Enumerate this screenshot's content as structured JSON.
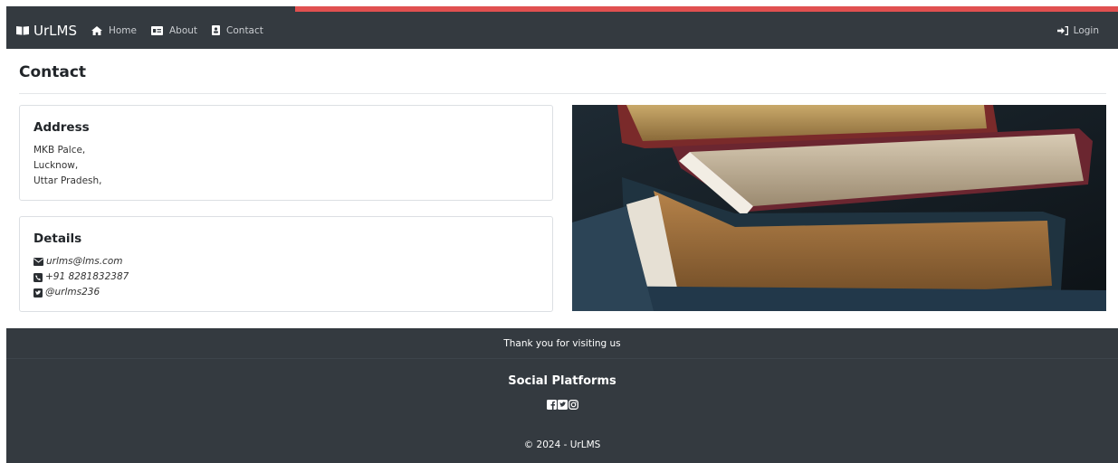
{
  "colors": {
    "navbar_bg": "#343a40",
    "progress_fill": "#e05050",
    "footer_bg": "#343a40"
  },
  "page_progress": 0.74,
  "navbar": {
    "brand": {
      "icon": "book-open-icon",
      "label": "UrLMS"
    },
    "links": [
      {
        "icon": "home-icon",
        "label": "Home"
      },
      {
        "icon": "id-card-icon",
        "label": "About"
      },
      {
        "icon": "contact-book-icon",
        "label": "Contact"
      }
    ],
    "login": {
      "icon": "sign-in-icon",
      "label": "Login"
    }
  },
  "page": {
    "title": "Contact"
  },
  "address_card": {
    "heading": "Address",
    "lines": [
      "MKB Palce,",
      "Lucknow,",
      "Uttar Pradesh,"
    ]
  },
  "details_card": {
    "heading": "Details",
    "items": [
      {
        "icon": "envelope-icon",
        "text": "urlms@lms.com"
      },
      {
        "icon": "phone-square-icon",
        "text": "+91 8281832387"
      },
      {
        "icon": "twitter-square-icon",
        "text": "@urlms236"
      }
    ]
  },
  "image": {
    "subject": "stack-of-old-books"
  },
  "footer": {
    "thanks": "Thank you for visiting us",
    "social_title": "Social Platforms",
    "social_icons": [
      "facebook-square-icon",
      "twitter-square-icon",
      "instagram-icon"
    ],
    "copyright": "© 2024 - UrLMS"
  }
}
